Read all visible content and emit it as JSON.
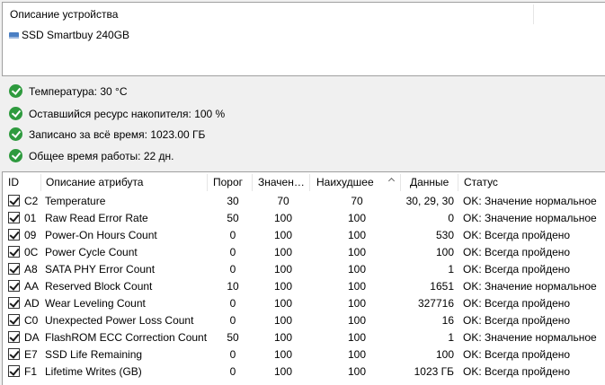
{
  "device_panel": {
    "header": "Описание устройства",
    "device_name": "SSD Smartbuy 240GB"
  },
  "summary": [
    {
      "text": "Температура: 30 °C",
      "icon": "check-circle-icon"
    },
    {
      "text": "Оставшийся ресурс накопителя: 100 %",
      "icon": "check-circle-icon"
    },
    {
      "text": "Записано за всё время: 1023.00 ГБ",
      "icon": "check-circle-icon"
    },
    {
      "text": "Общее время работы: 22 дн.",
      "icon": "check-circle-icon"
    }
  ],
  "table": {
    "columns": {
      "id": "ID",
      "name": "Описание атрибута",
      "threshold": "Порог",
      "value": "Значен…",
      "worst": "Наихудшее",
      "data": "Данные",
      "status": "Статус"
    },
    "rows": [
      {
        "checked": true,
        "id": "C2",
        "name": "Temperature",
        "threshold": "30",
        "value": "70",
        "worst": "70",
        "data": "30, 29, 30",
        "status": "OK: Значение нормальное"
      },
      {
        "checked": true,
        "id": "01",
        "name": "Raw Read Error Rate",
        "threshold": "50",
        "value": "100",
        "worst": "100",
        "data": "0",
        "status": "OK: Значение нормальное"
      },
      {
        "checked": true,
        "id": "09",
        "name": "Power-On Hours Count",
        "threshold": "0",
        "value": "100",
        "worst": "100",
        "data": "530",
        "status": "OK: Всегда пройдено"
      },
      {
        "checked": true,
        "id": "0C",
        "name": "Power Cycle Count",
        "threshold": "0",
        "value": "100",
        "worst": "100",
        "data": "100",
        "status": "OK: Всегда пройдено"
      },
      {
        "checked": true,
        "id": "A8",
        "name": "SATA PHY Error Count",
        "threshold": "0",
        "value": "100",
        "worst": "100",
        "data": "1",
        "status": "OK: Всегда пройдено"
      },
      {
        "checked": true,
        "id": "AA",
        "name": "Reserved Block Count",
        "threshold": "10",
        "value": "100",
        "worst": "100",
        "data": "1651",
        "status": "OK: Значение нормальное"
      },
      {
        "checked": true,
        "id": "AD",
        "name": "Wear Leveling Count",
        "threshold": "0",
        "value": "100",
        "worst": "100",
        "data": "327716",
        "status": "OK: Всегда пройдено"
      },
      {
        "checked": true,
        "id": "C0",
        "name": "Unexpected Power Loss Count",
        "threshold": "0",
        "value": "100",
        "worst": "100",
        "data": "16",
        "status": "OK: Всегда пройдено"
      },
      {
        "checked": true,
        "id": "DA",
        "name": "FlashROM ECC Correction Count",
        "threshold": "50",
        "value": "100",
        "worst": "100",
        "data": "1",
        "status": "OK: Значение нормальное"
      },
      {
        "checked": true,
        "id": "E7",
        "name": "SSD Life Remaining",
        "threshold": "0",
        "value": "100",
        "worst": "100",
        "data": "100",
        "status": "OK: Всегда пройдено"
      },
      {
        "checked": true,
        "id": "F1",
        "name": "Lifetime Writes (GB)",
        "threshold": "0",
        "value": "100",
        "worst": "100",
        "data": "1023 ГБ",
        "status": "OK: Всегда пройдено"
      }
    ]
  },
  "colors": {
    "check_green": "#2e9a3e",
    "drive_blue": "#4a7fc4"
  }
}
